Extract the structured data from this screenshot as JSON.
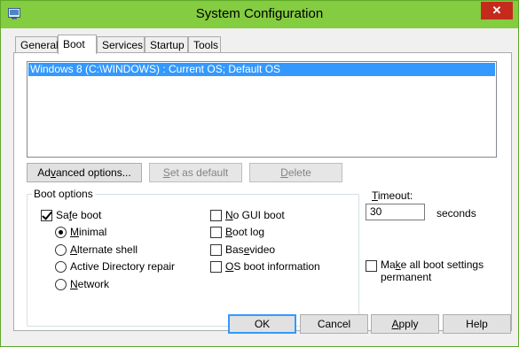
{
  "window": {
    "title": "System Configuration",
    "close_glyph": "✕",
    "icon": "msconfig-icon"
  },
  "tabs": [
    {
      "label": "General",
      "active": false
    },
    {
      "label": "Boot",
      "active": true
    },
    {
      "label": "Services",
      "active": false
    },
    {
      "label": "Startup",
      "active": false
    },
    {
      "label": "Tools",
      "active": false
    }
  ],
  "boot_list": {
    "items": [
      "Windows 8 (C:\\WINDOWS) : Current OS; Default OS"
    ]
  },
  "buttons": {
    "advanced": {
      "pre": "Ad",
      "u": "v",
      "post": "anced options..."
    },
    "set_default": {
      "pre": "",
      "u": "S",
      "post": "et as default"
    },
    "delete": {
      "pre": "",
      "u": "D",
      "post": "elete"
    }
  },
  "boot_options": {
    "group_label": "Boot options",
    "safe_boot": {
      "pre": "Sa",
      "u": "f",
      "post": "e boot",
      "checked": true
    },
    "minimal": {
      "pre": "",
      "u": "M",
      "post": "inimal",
      "selected": true
    },
    "alternate_shell": {
      "pre": "",
      "u": "A",
      "post": "lternate shell",
      "selected": false
    },
    "ad_repair": {
      "label": "Active Directory repair",
      "selected": false
    },
    "network": {
      "pre": "",
      "u": "N",
      "post": "etwork",
      "selected": false
    },
    "no_gui_boot": {
      "pre": "",
      "u": "N",
      "post": "o GUI boot",
      "checked": false
    },
    "boot_log": {
      "pre": "",
      "u": "B",
      "post": "oot log",
      "checked": false
    },
    "base_video": {
      "pre": "Bas",
      "u": "e",
      "post": " video",
      "checked": false
    },
    "os_boot_info": {
      "pre": "",
      "u": "O",
      "post": "S boot information",
      "checked": false
    }
  },
  "timeout": {
    "label_pre": "",
    "label_u": "T",
    "label_post": "imeout:",
    "value": "30",
    "unit": "seconds"
  },
  "make_permanent": {
    "pre": "Ma",
    "u": "k",
    "post": "e all boot settings",
    "line2": "permanent",
    "checked": false
  },
  "footer": {
    "ok": "OK",
    "cancel": "Cancel",
    "apply_u": "A",
    "apply_post": "pply",
    "help": "Help"
  }
}
